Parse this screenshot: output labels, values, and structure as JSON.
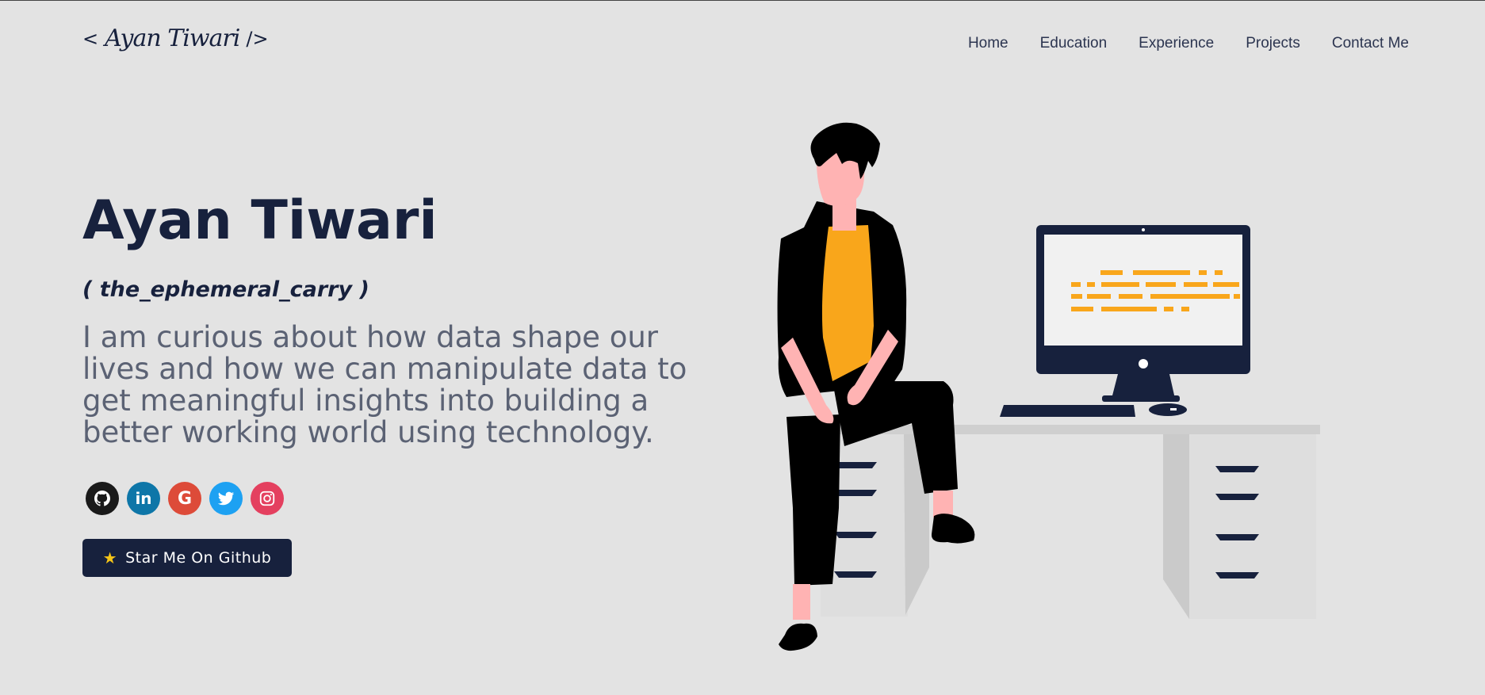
{
  "logo": {
    "open": "<",
    "signature": "Ayan Tiwari",
    "close": "/>"
  },
  "nav": {
    "items": [
      "Home",
      "Education",
      "Experience",
      "Projects",
      "Contact Me"
    ]
  },
  "hero": {
    "name": "Ayan Tiwari",
    "handle": "( the_ephemeral_carry )",
    "bio": "I am curious about how data shape our lives and how we can manipulate data to get meaningful insights into building a better working world using technology."
  },
  "socials": [
    {
      "icon": "github-icon",
      "color": "#1a1a1a",
      "glyph": "●"
    },
    {
      "icon": "linkedin-icon",
      "color": "#0e76a8",
      "glyph": "in"
    },
    {
      "icon": "google-icon",
      "color": "#dd4b39",
      "glyph": "G"
    },
    {
      "icon": "twitter-icon",
      "color": "#1da1f2",
      "glyph": "✦"
    },
    {
      "icon": "instagram-icon",
      "color": "#e4405f",
      "glyph": "◎"
    }
  ],
  "cta": {
    "icon": "star-icon",
    "label": "Star Me On Github"
  },
  "colors": {
    "background": "#e3e3e3",
    "primary": "#17213d",
    "text_muted": "#5b6274",
    "accent": "#f9a61b"
  }
}
